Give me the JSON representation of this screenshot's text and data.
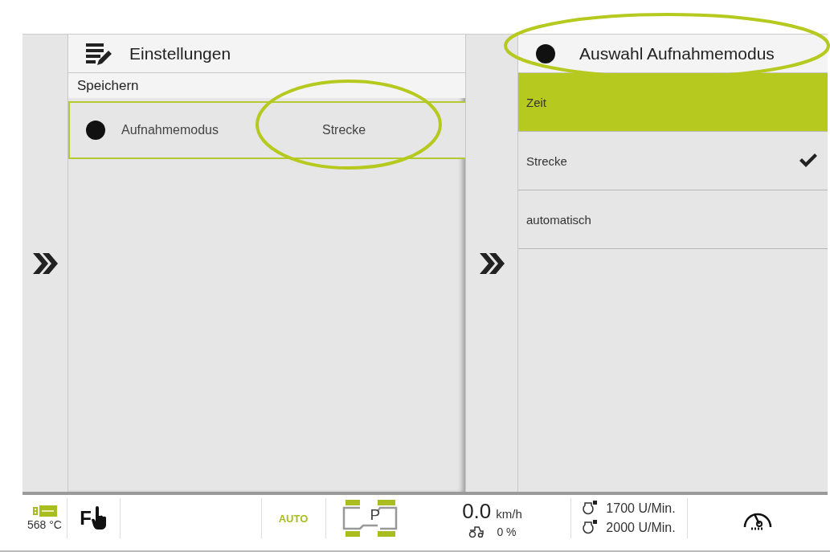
{
  "left_panel": {
    "title": "Einstellungen",
    "section": "Speichern",
    "items": [
      {
        "label": "Aufnahmemodus",
        "value": "Strecke"
      }
    ]
  },
  "right_panel": {
    "title": "Auswahl Aufnahmemodus",
    "options": [
      {
        "label": "Zeit",
        "selected": true,
        "checked": false
      },
      {
        "label": "Strecke",
        "selected": false,
        "checked": true
      },
      {
        "label": "automatisch",
        "selected": false,
        "checked": false
      }
    ]
  },
  "status_bar": {
    "temperature": "568 °C",
    "function_key": "F",
    "mode": "AUTO",
    "gear": "P",
    "speed": "0.0",
    "speed_unit": "km/h",
    "slip": "0 %",
    "engine_rpm_1": "1700 U/Min.",
    "engine_rpm_2": "2000 U/Min."
  }
}
